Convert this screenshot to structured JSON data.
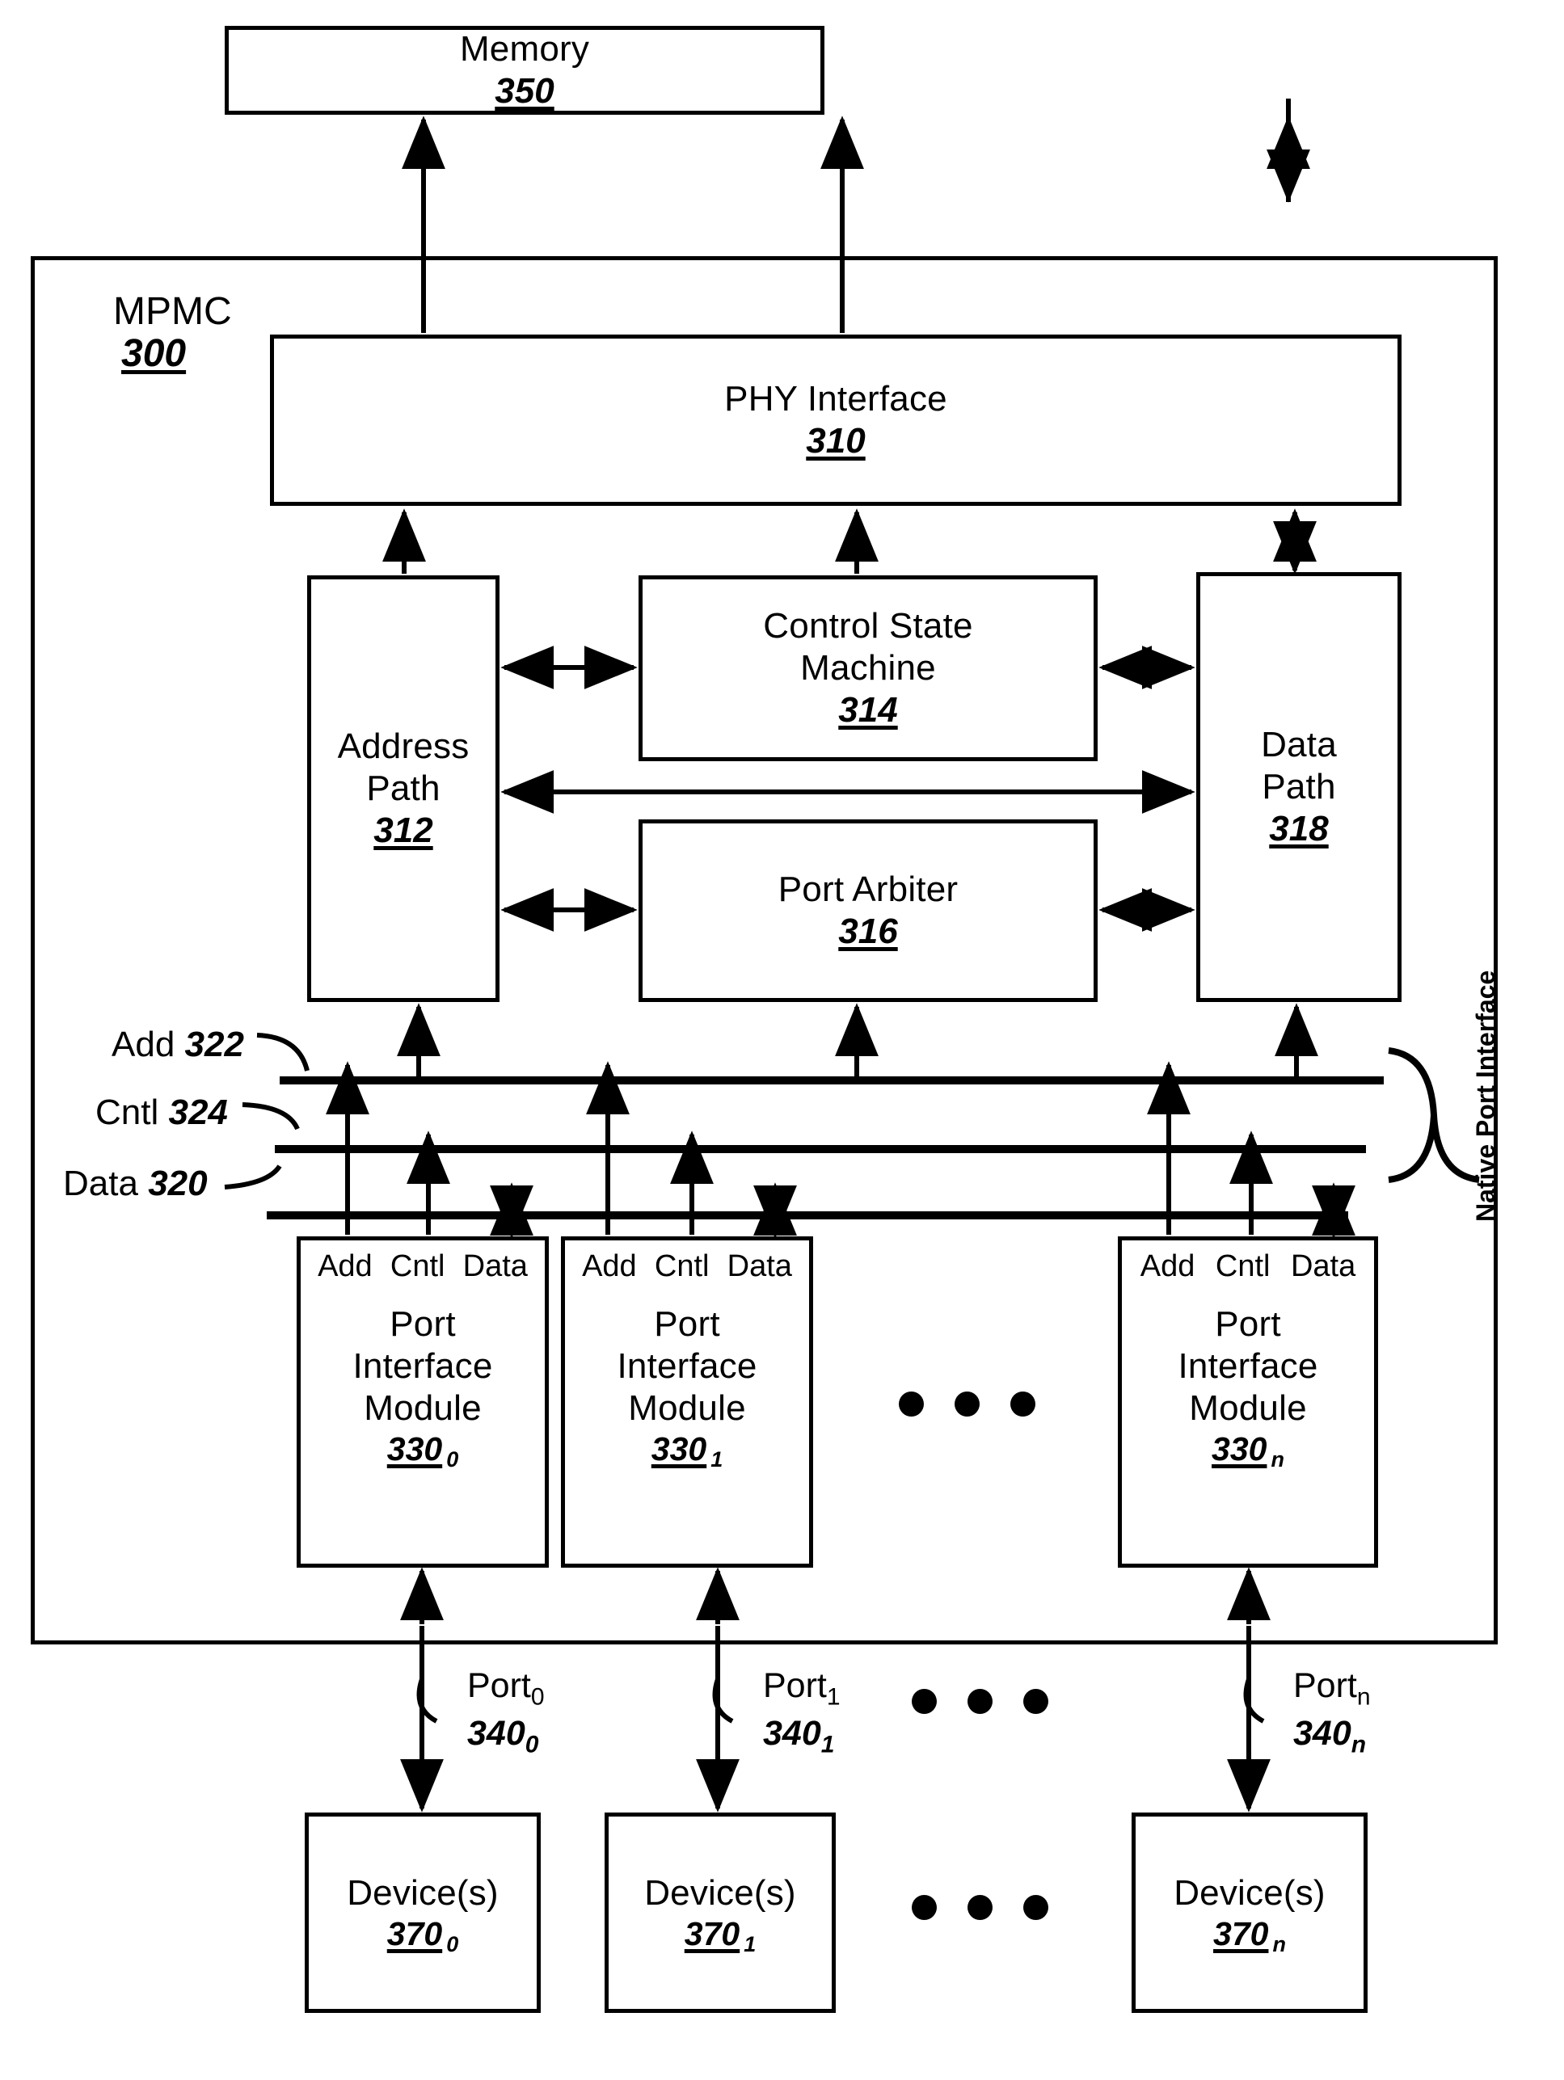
{
  "figure": {
    "memory": {
      "label": "Memory",
      "ref": "350"
    },
    "mpmc": {
      "label": "MPMC",
      "ref": "300"
    },
    "phy": {
      "label": "PHY Interface",
      "ref": "310"
    },
    "address_path": {
      "line1": "Address",
      "line2": "Path",
      "ref": "312"
    },
    "control_state_machine": {
      "line1": "Control State",
      "line2": "Machine",
      "ref": "314"
    },
    "port_arbiter": {
      "label": "Port Arbiter",
      "ref": "316"
    },
    "data_path": {
      "line1": "Data",
      "line2": "Path",
      "ref": "318"
    },
    "buses": [
      {
        "name": "Add",
        "ref": "322"
      },
      {
        "name": "Cntl",
        "ref": "324"
      },
      {
        "name": "Data",
        "ref": "320"
      }
    ],
    "native_port_interface_label": "Native Port Interface",
    "pim_signal_headers": [
      "Add",
      "Cntl",
      "Data"
    ],
    "port_interface_modules": [
      {
        "line1": "Port",
        "line2": "Interface",
        "line3": "Module",
        "ref": "330",
        "sub": "0"
      },
      {
        "line1": "Port",
        "line2": "Interface",
        "line3": "Module",
        "ref": "330",
        "sub": "1"
      },
      {
        "line1": "Port",
        "line2": "Interface",
        "line3": "Module",
        "ref": "330",
        "sub": "n"
      }
    ],
    "ports": [
      {
        "name": "Port",
        "sub": "0",
        "ref": "340",
        "refsub": "0"
      },
      {
        "name": "Port",
        "sub": "1",
        "ref": "340",
        "refsub": "1"
      },
      {
        "name": "Port",
        "sub": "n",
        "ref": "340",
        "refsub": "n"
      }
    ],
    "devices": [
      {
        "label": "Device(s)",
        "ref": "370",
        "sub": "0"
      },
      {
        "label": "Device(s)",
        "ref": "370",
        "sub": "1"
      },
      {
        "label": "Device(s)",
        "ref": "370",
        "sub": "n"
      }
    ],
    "ellipsis_glyph": "● ● ●",
    "stroke_color": "#000000",
    "background_color": "#ffffff"
  }
}
